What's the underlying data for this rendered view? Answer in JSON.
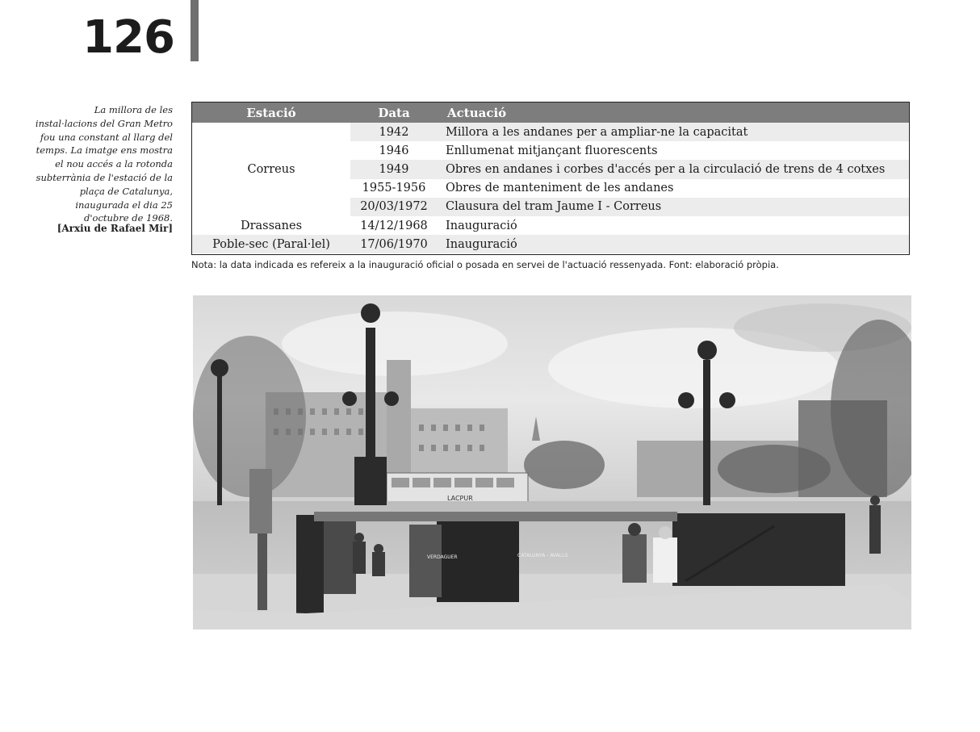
{
  "page_number": "126",
  "caption": {
    "text": "La millora de les instal·lacions del Gran Metro fou una constant al llarg del temps. La imatge ens mostra el nou accés a la rotonda subterrània de l'estació de la plaça de Catalunya, inaugurada el dia 25 d'octubre de 1968.",
    "credit": "[Arxiu de Rafael Mir]"
  },
  "table": {
    "headers": {
      "station": "Estació",
      "date": "Data",
      "action": "Actuació"
    },
    "groups": [
      {
        "station": "Correus",
        "rows": [
          {
            "date": "1942",
            "action": "Millora a les andanes per a ampliar-ne la capacitat"
          },
          {
            "date": "1946",
            "action": "Enllumenat mitjançant fluorescents"
          },
          {
            "date": "1949",
            "action": "Obres en andanes i corbes d'accés per a la circulació de trens de 4 cotxes"
          },
          {
            "date": "1955-1956",
            "action": "Obres de manteniment de les andanes"
          },
          {
            "date": "20/03/1972",
            "action": "Clausura del tram Jaume I - Correus"
          }
        ]
      },
      {
        "station": "Drassanes",
        "rows": [
          {
            "date": "14/12/1968",
            "action": "Inauguració"
          }
        ]
      },
      {
        "station": "Poble-sec (Paral·lel)",
        "rows": [
          {
            "date": "17/06/1970",
            "action": "Inauguració"
          }
        ]
      }
    ]
  },
  "note": "Nota: la data indicada es refereix a la inauguració oficial o posada en servei de l'actuació ressenyada. Font: elaboració pròpia.",
  "photo": {
    "signs": [
      "VERDAGUER",
      "CATALUNYA - AVALLS",
      "LACPUR"
    ]
  },
  "colors": {
    "header_bg": "#7d7d7d",
    "row_shade": "#ececec",
    "header_rule": "#6f6f6f"
  }
}
